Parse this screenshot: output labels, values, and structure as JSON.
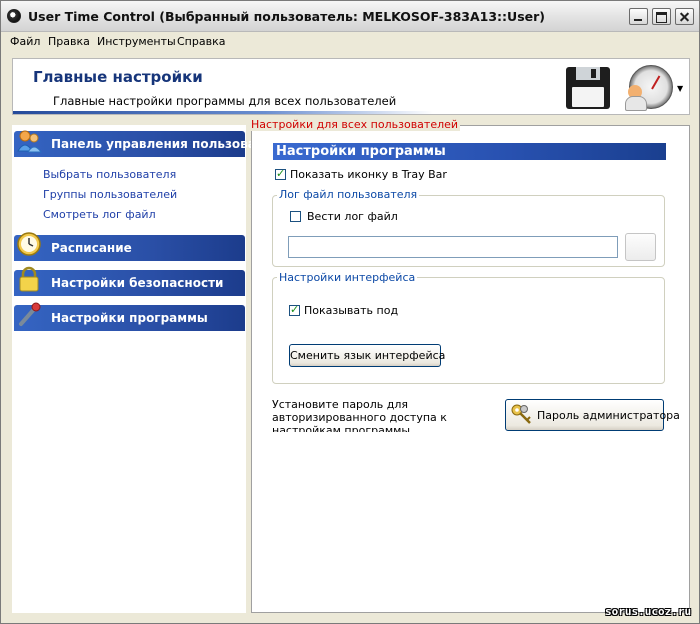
{
  "window": {
    "title": "User Time Control (Выбранный пользователь: MELKOSOF-383A13::User)",
    "buttons": [
      "minimize",
      "maximize",
      "close"
    ]
  },
  "menu": [
    "Файл",
    "Правка",
    "Инструменты",
    "Справка"
  ],
  "header": {
    "title": "Главные настройки",
    "subtitle": "Главные настройки программы для всех пользователей",
    "icons": [
      "floppy-save-icon",
      "user-clock-icon"
    ]
  },
  "sidebar": {
    "panels": [
      {
        "label": "Панель управления пользоват",
        "icon": "users-icon",
        "links": [
          "Выбрать пользователя",
          "Группы пользователей",
          "Смотреть лог файл"
        ]
      },
      {
        "label": "Расписание",
        "icon": "clock-icon"
      },
      {
        "label": "Настройки безопасности",
        "icon": "lock-icon"
      },
      {
        "label": "Настройки программы",
        "icon": "wrench-icon"
      }
    ]
  },
  "main": {
    "all_users_note": "Настройки для всех пользователей",
    "section_title": "Настройки программы",
    "tray_checkbox": {
      "label": "Показать иконку в Tray Bar",
      "checked": true
    },
    "log_group": {
      "legend": "Лог файл пользователя",
      "checkbox": {
        "label": "Вести лог файл",
        "checked": false
      },
      "path_value": ""
    },
    "interface_group": {
      "legend": "Настройки интерфейса",
      "checkbox": {
        "label": "Показывать под",
        "checked": true
      },
      "change_language_button": "Сменить язык интерфейса"
    },
    "password_note": "Установите пароль для авторизированного доступа к настройкам программы",
    "admin_password_button": "Пароль администратора"
  },
  "watermark": "sorus.ucoz.ru",
  "colors": {
    "nav_header": "#2a4fa6",
    "section_header": "#2851b0",
    "link": "#1f3fa8",
    "note_red": "#d00000",
    "legend_blue": "#0c49a6"
  }
}
